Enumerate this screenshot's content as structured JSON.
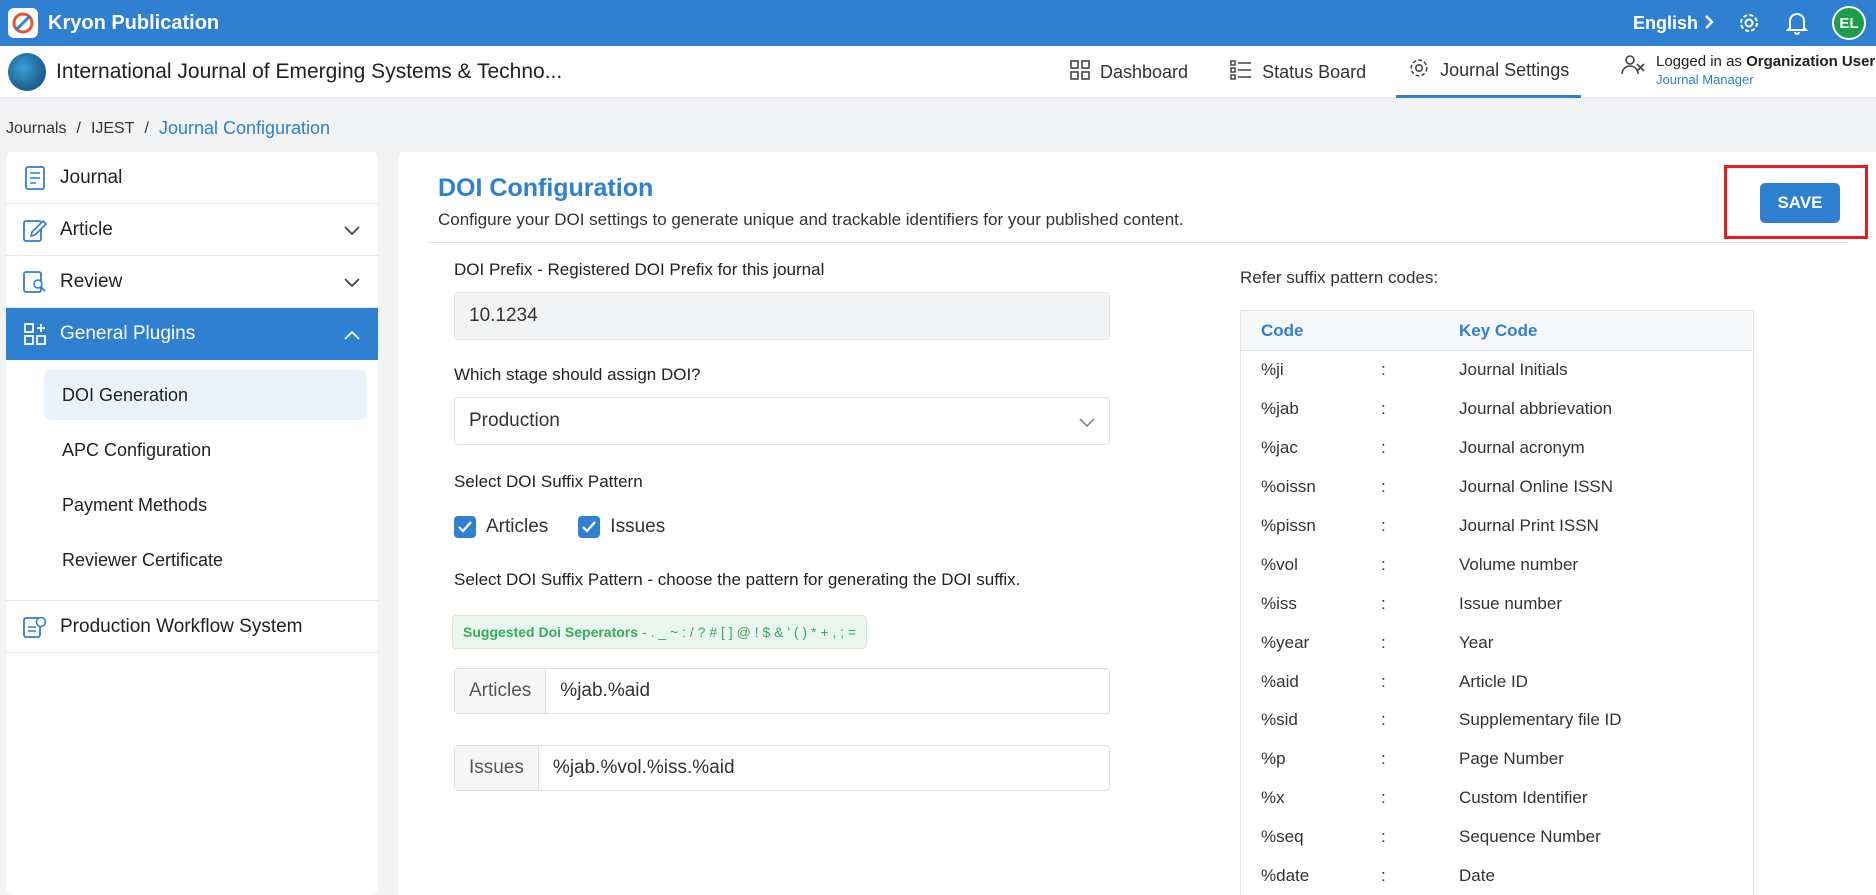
{
  "topbar": {
    "brand": "Kryon Publication",
    "language": "English",
    "avatar": "EL"
  },
  "header": {
    "journal_title": "International Journal of Emerging Systems & Techno...",
    "nav": [
      {
        "label": "Dashboard",
        "icon": "grid-icon"
      },
      {
        "label": "Status Board",
        "icon": "status-board-icon"
      },
      {
        "label": "Journal Settings",
        "icon": "gear-icon"
      }
    ],
    "user_prefix": "Logged in as",
    "user_name": "Organization User",
    "user_role": "Journal Manager"
  },
  "breadcrumb": {
    "items": [
      "Journals",
      "IJEST",
      "Journal Configuration"
    ],
    "separator": "/"
  },
  "sidebar": {
    "items": [
      {
        "label": "Journal"
      },
      {
        "label": "Article"
      },
      {
        "label": "Review"
      },
      {
        "label": "General Plugins"
      }
    ],
    "sub_items": [
      {
        "label": "DOI Generation"
      },
      {
        "label": "APC Configuration"
      },
      {
        "label": "Payment Methods"
      },
      {
        "label": "Reviewer Certificate"
      }
    ],
    "last_item": {
      "label": "Production Workflow System"
    }
  },
  "main": {
    "title": "DOI Configuration",
    "description": "Configure your DOI settings to generate unique and trackable identifiers for your published content.",
    "save_label": "SAVE",
    "doi_prefix_label": "DOI Prefix - Registered DOI Prefix for this journal",
    "doi_prefix_value": "10.1234",
    "stage_label": "Which stage should assign DOI?",
    "stage_value": "Production",
    "suffix_pattern_label": "Select DOI Suffix Pattern",
    "check_articles": "Articles",
    "check_issues": "Issues",
    "suffix_pattern_desc": "Select DOI Suffix Pattern - choose the pattern for generating the DOI suffix.",
    "separators_label": "Suggested Doi Seperators",
    "separators_chars": "- . _ ~ : / ? # [ ] @ ! $ & ' ( ) * + , ; =",
    "articles_addon": "Articles",
    "articles_value": "%jab.%aid",
    "issues_addon": "Issues",
    "issues_value": "%jab.%vol.%iss.%aid"
  },
  "codes": {
    "refer_label": "Refer suffix pattern codes:",
    "header_code": "Code",
    "header_key": "Key Code",
    "separator": ":",
    "rows": [
      {
        "code": "%ji",
        "key": "Journal Initials"
      },
      {
        "code": "%jab",
        "key": "Journal abbrievation"
      },
      {
        "code": "%jac",
        "key": "Journal acronym"
      },
      {
        "code": "%oissn",
        "key": "Journal Online ISSN"
      },
      {
        "code": "%pissn",
        "key": "Journal Print ISSN"
      },
      {
        "code": "%vol",
        "key": "Volume number"
      },
      {
        "code": "%iss",
        "key": "Issue number"
      },
      {
        "code": "%year",
        "key": "Year"
      },
      {
        "code": "%aid",
        "key": "Article ID"
      },
      {
        "code": "%sid",
        "key": "Supplementary file ID"
      },
      {
        "code": "%p",
        "key": "Page Number"
      },
      {
        "code": "%x",
        "key": "Custom Identifier"
      },
      {
        "code": "%seq",
        "key": "Sequence Number"
      },
      {
        "code": "%date",
        "key": "Date"
      }
    ]
  },
  "colors": {
    "primary": "#2f80d1",
    "highlight": "#e02020",
    "success": "#3aaa5c"
  }
}
